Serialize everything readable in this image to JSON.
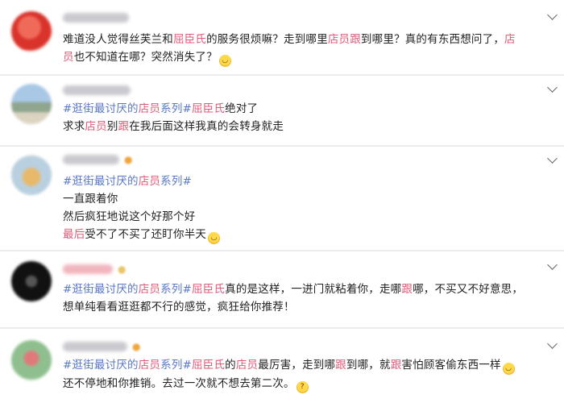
{
  "colors": {
    "text": "#222222",
    "topic": "#5a77c7",
    "highlight": "#e05a78",
    "background": "#ececec",
    "card": "#ffffff"
  },
  "icons": {
    "more": "chevron-down-icon",
    "emoji_laugh": "laugh-cry-emoji-icon",
    "emoji_thinking": "thinking-emoji-icon"
  },
  "posts": [
    {
      "lines": [
        [
          {
            "t": "难道没人觉得丝芙兰和",
            "k": "n"
          },
          {
            "t": "屈臣氏",
            "k": "h"
          },
          {
            "t": "的服务很烦嘛？走到哪里",
            "k": "n"
          },
          {
            "t": "店员",
            "k": "h"
          },
          {
            "t": "跟",
            "k": "h"
          },
          {
            "t": "到哪里？真的有东西想问了，",
            "k": "n"
          },
          {
            "t": "店",
            "k": "h"
          }
        ],
        [
          {
            "t": "员",
            "k": "h"
          },
          {
            "t": "也不知道在哪？突然消失了？",
            "k": "n"
          },
          {
            "t": "",
            "k": "e"
          }
        ]
      ]
    },
    {
      "lines": [
        [
          {
            "t": "#逛街最讨厌的",
            "k": "t"
          },
          {
            "t": "店员",
            "k": "h"
          },
          {
            "t": "系列#",
            "k": "t"
          },
          {
            "t": "屈臣氏",
            "k": "h"
          },
          {
            "t": "绝对了",
            "k": "n"
          }
        ],
        [
          {
            "t": "求求",
            "k": "n"
          },
          {
            "t": "店员",
            "k": "h"
          },
          {
            "t": "别",
            "k": "n"
          },
          {
            "t": "跟",
            "k": "h"
          },
          {
            "t": "在我后面这样我真的会转身就走",
            "k": "n"
          }
        ]
      ]
    },
    {
      "lines": [
        [
          {
            "t": "#逛街最讨厌的",
            "k": "t"
          },
          {
            "t": "店员",
            "k": "h"
          },
          {
            "t": "系列#",
            "k": "t"
          }
        ],
        [
          {
            "t": "一直跟着你",
            "k": "n"
          }
        ],
        [
          {
            "t": "然后疯狂地说这个好那个好",
            "k": "n"
          }
        ],
        [
          {
            "t": "最后",
            "k": "h"
          },
          {
            "t": "受不了不买了还盯你半天",
            "k": "n"
          },
          {
            "t": "",
            "k": "e"
          }
        ]
      ]
    },
    {
      "lines": [
        [
          {
            "t": "#逛街最讨厌的",
            "k": "t"
          },
          {
            "t": "店员",
            "k": "h"
          },
          {
            "t": "系列#",
            "k": "t"
          },
          {
            "t": "屈臣氏",
            "k": "h"
          },
          {
            "t": "真的是这样，一进门就粘着你，走哪",
            "k": "n"
          },
          {
            "t": "跟",
            "k": "h"
          },
          {
            "t": "哪，不买又不好意思，",
            "k": "n"
          }
        ],
        [
          {
            "t": "想单纯看看逛逛都不行的感觉，疯狂给你推荐！",
            "k": "n"
          }
        ]
      ]
    },
    {
      "lines": [
        [
          {
            "t": "#逛街最讨厌的",
            "k": "t"
          },
          {
            "t": "店员",
            "k": "h"
          },
          {
            "t": "系列#",
            "k": "t"
          },
          {
            "t": "屈臣氏",
            "k": "h"
          },
          {
            "t": "的",
            "k": "n"
          },
          {
            "t": "店员",
            "k": "h"
          },
          {
            "t": "最厉害，走到哪",
            "k": "n"
          },
          {
            "t": "跟",
            "k": "h"
          },
          {
            "t": "到哪，就",
            "k": "n"
          },
          {
            "t": "跟",
            "k": "h"
          },
          {
            "t": "害怕顾客偷东西一样",
            "k": "n"
          },
          {
            "t": "",
            "k": "e"
          }
        ],
        [
          {
            "t": "还不停地和你推销。去过一次就不想去第二次。",
            "k": "n"
          },
          {
            "t": "",
            "k": "e2"
          }
        ]
      ]
    }
  ]
}
